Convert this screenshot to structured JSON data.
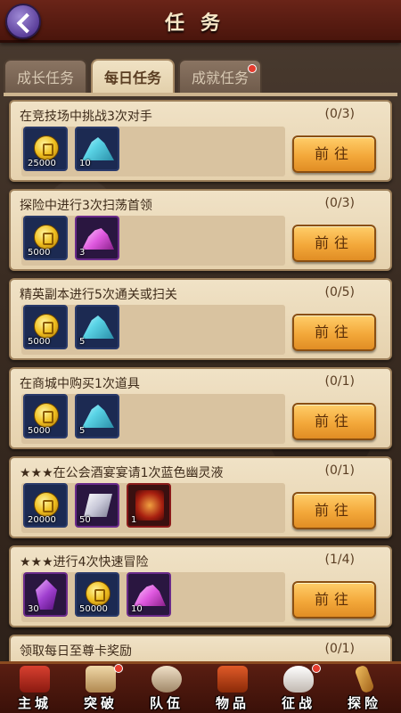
{
  "header": {
    "title": "任务"
  },
  "tabs": [
    {
      "label": "成长任务",
      "active": false,
      "dot": false
    },
    {
      "label": "每日任务",
      "active": true,
      "dot": false
    },
    {
      "label": "成就任务",
      "active": false,
      "dot": true
    }
  ],
  "tasks": [
    {
      "title": "在竞技场中挑战3次对手",
      "progress": "(0/3)",
      "button": "前往",
      "rewards": [
        {
          "icon": "gold-coin-icon",
          "count": "25000"
        },
        {
          "icon": "teal-crystal-icon",
          "count": "10"
        }
      ]
    },
    {
      "title": "探险中进行3次扫荡首领",
      "progress": "(0/3)",
      "button": "前往",
      "rewards": [
        {
          "icon": "gold-coin-icon",
          "count": "5000"
        },
        {
          "icon": "pink-crystal-icon",
          "count": "3"
        }
      ]
    },
    {
      "title": "精英副本进行5次通关或扫关",
      "progress": "(0/5)",
      "button": "前往",
      "rewards": [
        {
          "icon": "gold-coin-icon",
          "count": "5000"
        },
        {
          "icon": "teal-crystal-icon",
          "count": "5"
        }
      ]
    },
    {
      "title": "在商城中购买1次道具",
      "progress": "(0/1)",
      "button": "前往",
      "rewards": [
        {
          "icon": "gold-coin-icon",
          "count": "5000"
        },
        {
          "icon": "teal-crystal-icon",
          "count": "5"
        }
      ]
    },
    {
      "title": "★★★在公会酒宴宴请1次蓝色幽灵液",
      "progress": "(0/1)",
      "button": "前往",
      "rewards": [
        {
          "icon": "gold-coin-icon",
          "count": "20000"
        },
        {
          "icon": "silver-bar-icon",
          "count": "50"
        },
        {
          "icon": "red-tome-icon",
          "count": "1"
        }
      ]
    },
    {
      "title": "★★★进行4次快速冒险",
      "progress": "(1/4)",
      "button": "前往",
      "rewards": [
        {
          "icon": "purple-gem-icon",
          "count": "30"
        },
        {
          "icon": "gold-coin-icon",
          "count": "50000"
        },
        {
          "icon": "pink-crystal-icon",
          "count": "10"
        }
      ]
    },
    {
      "title": "领取每日至尊卡奖励",
      "progress": "(0/1)",
      "button": "",
      "rewards": []
    }
  ],
  "nav": [
    {
      "label": "主城",
      "icon": "city-gate-icon",
      "dot": false
    },
    {
      "label": "突破",
      "icon": "scroll-icon",
      "dot": true
    },
    {
      "label": "队伍",
      "icon": "team-icon",
      "dot": false
    },
    {
      "label": "物品",
      "icon": "chest-icon",
      "dot": false
    },
    {
      "label": "征战",
      "icon": "fox-mask-icon",
      "dot": true
    },
    {
      "label": "探险",
      "icon": "sword-icon",
      "dot": false
    }
  ],
  "colors": {
    "accent": "#f3a83a",
    "header": "#6a2418",
    "card": "#f0e2c6"
  }
}
